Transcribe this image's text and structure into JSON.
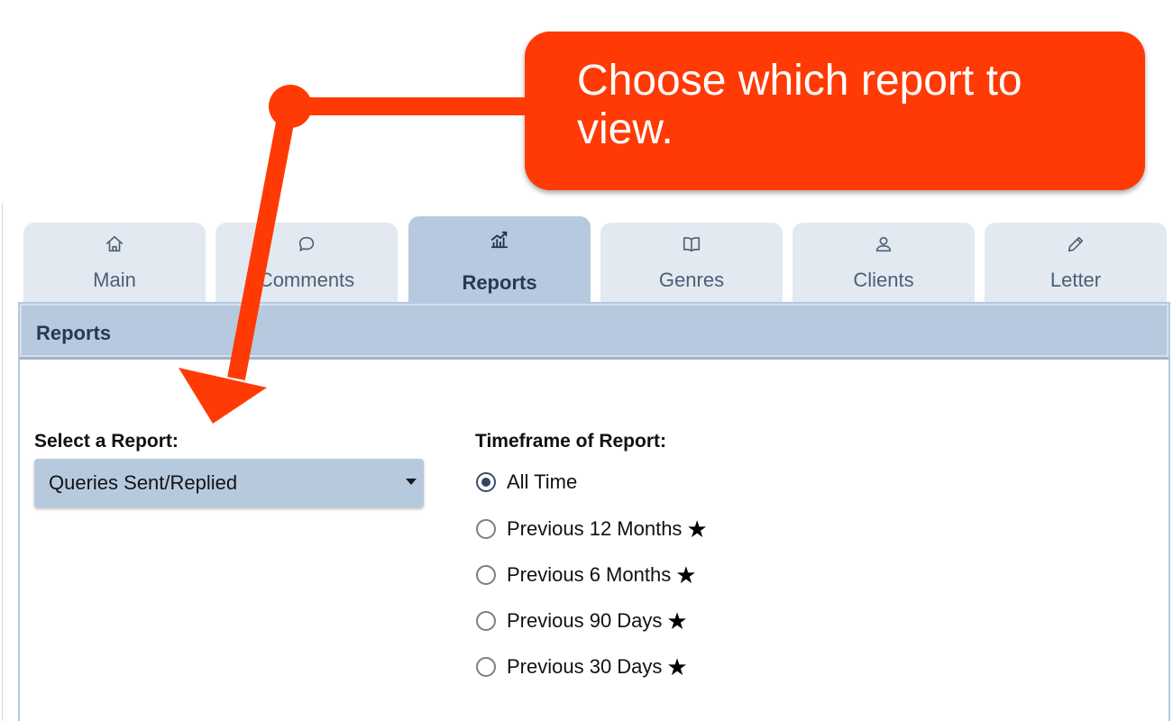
{
  "annotation": {
    "text": "Choose which report to view.",
    "color": "#ff3a04"
  },
  "tabs": [
    {
      "label": "Main",
      "icon": "home-icon",
      "active": false
    },
    {
      "label": "Comments",
      "icon": "speech-bubble-icon",
      "active": false
    },
    {
      "label": "Reports",
      "icon": "chart-icon",
      "active": true
    },
    {
      "label": "Genres",
      "icon": "book-icon",
      "active": false
    },
    {
      "label": "Clients",
      "icon": "user-icon",
      "active": false
    },
    {
      "label": "Letter",
      "icon": "pencil-icon",
      "active": false
    }
  ],
  "panel": {
    "title": "Reports"
  },
  "report_select": {
    "label": "Select a Report:",
    "value": "Queries Sent/Replied"
  },
  "timeframe": {
    "label": "Timeframe of Report:",
    "options": [
      {
        "label": "All Time",
        "checked": true,
        "star": false
      },
      {
        "label": "Previous 12 Months",
        "checked": false,
        "star": true
      },
      {
        "label": "Previous 6 Months",
        "checked": false,
        "star": true
      },
      {
        "label": "Previous 90 Days",
        "checked": false,
        "star": true
      },
      {
        "label": "Previous 30 Days",
        "checked": false,
        "star": true
      }
    ],
    "star_glyph": "★"
  },
  "colors": {
    "tab_bg": "#e3e9f1",
    "tab_active_bg": "#b6c9de",
    "header_bg": "#b6c9de",
    "select_bg": "#b7c9dd"
  }
}
